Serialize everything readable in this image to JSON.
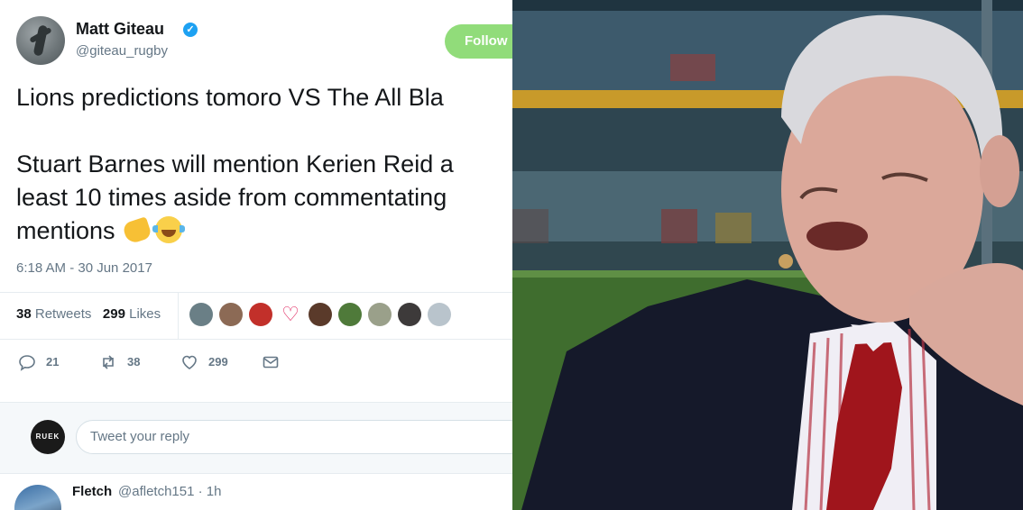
{
  "tweet": {
    "author": {
      "display_name": "Matt Giteau",
      "handle": "@giteau_rugby",
      "verified_icon": "verified-badge-icon",
      "avatar_icon": "profile-photo"
    },
    "follow_button_label": "Follow",
    "text_lines": [
      "Lions predictions tomoro VS The All Bla",
      "",
      "Stuart Barnes will mention Kerien Reid a",
      "least 10 times aside from commentating",
      "mentions"
    ],
    "emojis": [
      "pointing-hand-emoji",
      "tears-of-joy-emoji"
    ],
    "timestamp": "6:18 AM - 30 Jun 2017",
    "stats": {
      "retweets_count": "38",
      "retweets_label": "Retweets",
      "likes_count": "299",
      "likes_label": "Likes"
    },
    "liker_avatars": [
      "liker-avatar-1",
      "liker-avatar-2",
      "liker-avatar-3",
      "liker-heart-avatar",
      "liker-avatar-5",
      "liker-avatar-6",
      "liker-avatar-7",
      "liker-avatar-8",
      "liker-avatar-9"
    ],
    "actions": {
      "reply_count": "21",
      "retweet_count": "38",
      "like_count": "299"
    },
    "reply_box": {
      "avatar_text": "RUEK",
      "placeholder": "Tweet your reply"
    },
    "reply": {
      "name": "Fletch",
      "meta": "@afletch151 · 1h"
    }
  },
  "colors": {
    "follow_green": "#91dc7a",
    "verified_blue": "#1da1f2",
    "tie_red": "#a0151c",
    "pitch_green": "#3f6d2e"
  }
}
